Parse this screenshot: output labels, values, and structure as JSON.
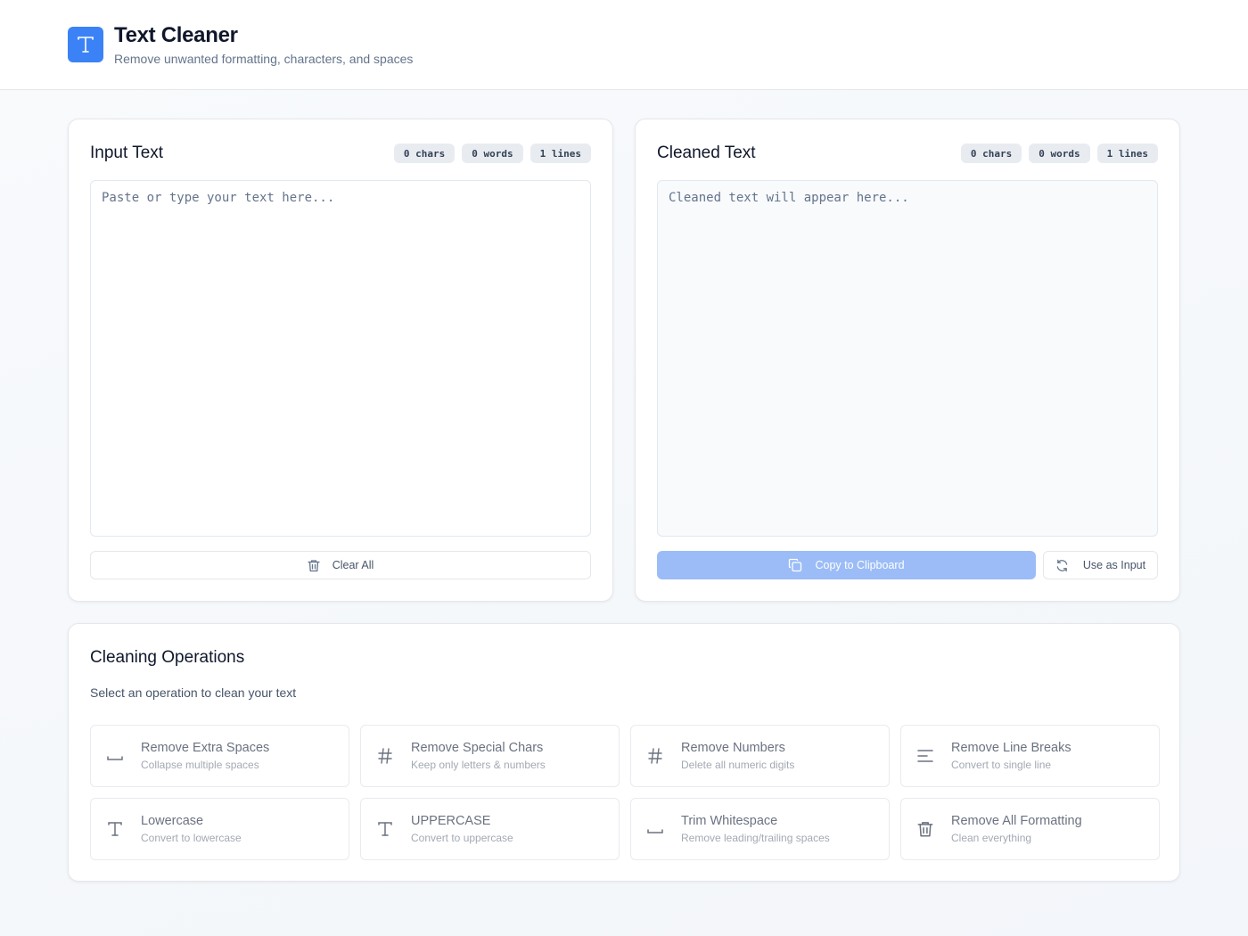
{
  "app": {
    "title": "Text Cleaner",
    "subtitle": "Remove unwanted formatting, characters, and spaces",
    "logo_icon": "text-t-icon",
    "accent_color": "#3b82f6"
  },
  "input_panel": {
    "title": "Input Text",
    "stats": {
      "chars": "0 chars",
      "words": "0 words",
      "lines": "1 lines"
    },
    "value": "",
    "placeholder": "Paste or type your text here...",
    "clear_button": {
      "label": "Clear All",
      "icon": "trash-icon"
    }
  },
  "output_panel": {
    "title": "Cleaned Text",
    "stats": {
      "chars": "0 chars",
      "words": "0 words",
      "lines": "1 lines"
    },
    "value": "",
    "placeholder": "Cleaned text will appear here...",
    "copy_button": {
      "label": "Copy to Clipboard",
      "icon": "copy-icon",
      "color": "#9bbcf6"
    },
    "use_button": {
      "label": "Use as Input",
      "icon": "refresh-icon"
    }
  },
  "operations": {
    "title": "Cleaning Operations",
    "description": "Select an operation to clean your text",
    "items": [
      {
        "name": "Remove Extra Spaces",
        "desc": "Collapse multiple spaces",
        "icon": "space-icon"
      },
      {
        "name": "Remove Special Chars",
        "desc": "Keep only letters & numbers",
        "icon": "hash-icon"
      },
      {
        "name": "Remove Numbers",
        "desc": "Delete all numeric digits",
        "icon": "hash-icon"
      },
      {
        "name": "Remove Line Breaks",
        "desc": "Convert to single line",
        "icon": "align-left-icon"
      },
      {
        "name": "Lowercase",
        "desc": "Convert to lowercase",
        "icon": "type-icon"
      },
      {
        "name": "UPPERCASE",
        "desc": "Convert to uppercase",
        "icon": "type-icon"
      },
      {
        "name": "Trim Whitespace",
        "desc": "Remove leading/trailing spaces",
        "icon": "space-icon"
      },
      {
        "name": "Remove All Formatting",
        "desc": "Clean everything",
        "icon": "trash-icon"
      }
    ]
  }
}
